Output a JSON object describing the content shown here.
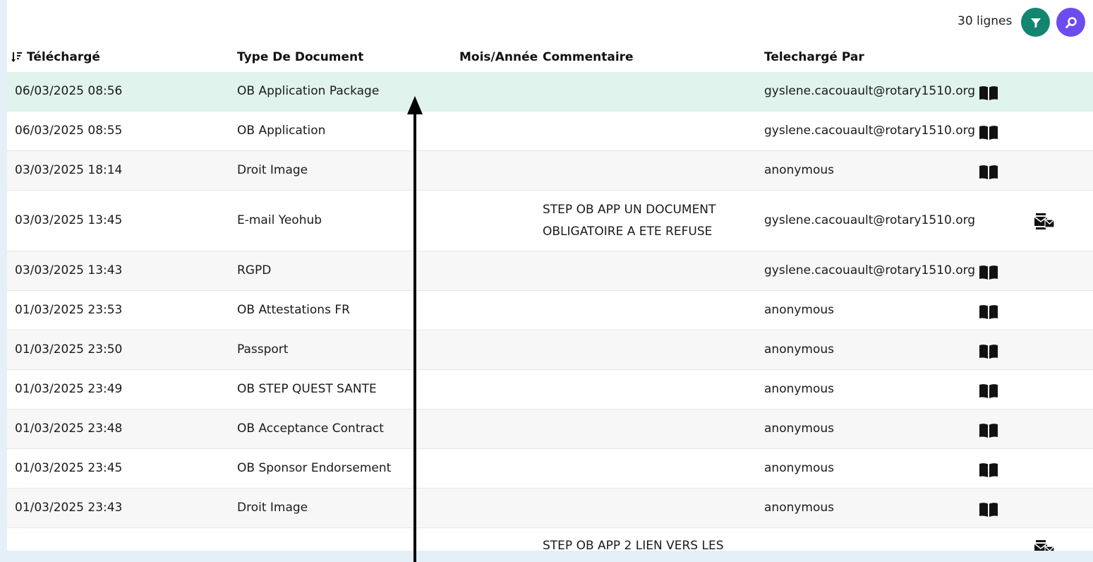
{
  "toolbar": {
    "row_count": "30 lignes",
    "filter_icon": "filter-icon",
    "search_icon": "search-icon",
    "filter_color": "#12856f",
    "search_color": "#6c4cf0"
  },
  "columns": {
    "uploaded": "Téléchargé",
    "doc_type": "Type De Document",
    "month_year": "Mois/Année",
    "comment": "Commentaire",
    "uploaded_by": "Telechargé Par",
    "sort_icon": "sort-descending-icon"
  },
  "rows": [
    {
      "date": "06/03/2025 08:56",
      "type": "OB Application Package",
      "comment": "",
      "by": "gyslene.cacouault@rotary1510.org",
      "icon": "book-icon"
    },
    {
      "date": "06/03/2025 08:55",
      "type": "OB Application",
      "comment": "",
      "by": "gyslene.cacouault@rotary1510.org",
      "icon": "book-icon"
    },
    {
      "date": "03/03/2025 18:14",
      "type": "Droit Image",
      "comment": "",
      "by": "anonymous",
      "icon": "book-icon"
    },
    {
      "date": "03/03/2025 13:45",
      "type": "E-mail Yeohub",
      "comment": "STEP OB APP UN DOCUMENT OBLIGATOIRE A ETE REFUSE",
      "by": "gyslene.cacouault@rotary1510.org",
      "icon": "mail-icon"
    },
    {
      "date": "03/03/2025 13:43",
      "type": "RGPD",
      "comment": "",
      "by": "gyslene.cacouault@rotary1510.org",
      "icon": "book-icon"
    },
    {
      "date": "01/03/2025 23:53",
      "type": "OB Attestations FR",
      "comment": "",
      "by": "anonymous",
      "icon": "book-icon"
    },
    {
      "date": "01/03/2025 23:50",
      "type": "Passport",
      "comment": "",
      "by": "anonymous",
      "icon": "book-icon"
    },
    {
      "date": "01/03/2025 23:49",
      "type": "OB STEP QUEST SANTE",
      "comment": "",
      "by": "anonymous",
      "icon": "book-icon"
    },
    {
      "date": "01/03/2025 23:48",
      "type": "OB Acceptance Contract",
      "comment": "",
      "by": "anonymous",
      "icon": "book-icon"
    },
    {
      "date": "01/03/2025 23:45",
      "type": "OB Sponsor Endorsement",
      "comment": "",
      "by": "anonymous",
      "icon": "book-icon"
    },
    {
      "date": "01/03/2025 23:43",
      "type": "Droit Image",
      "comment": "",
      "by": "anonymous",
      "icon": "book-icon"
    },
    {
      "date": "",
      "type": "",
      "comment": "STEP OB APP 2 LIEN VERS LES",
      "by": "",
      "icon": "mail-icon"
    }
  ],
  "selected_row": 0
}
